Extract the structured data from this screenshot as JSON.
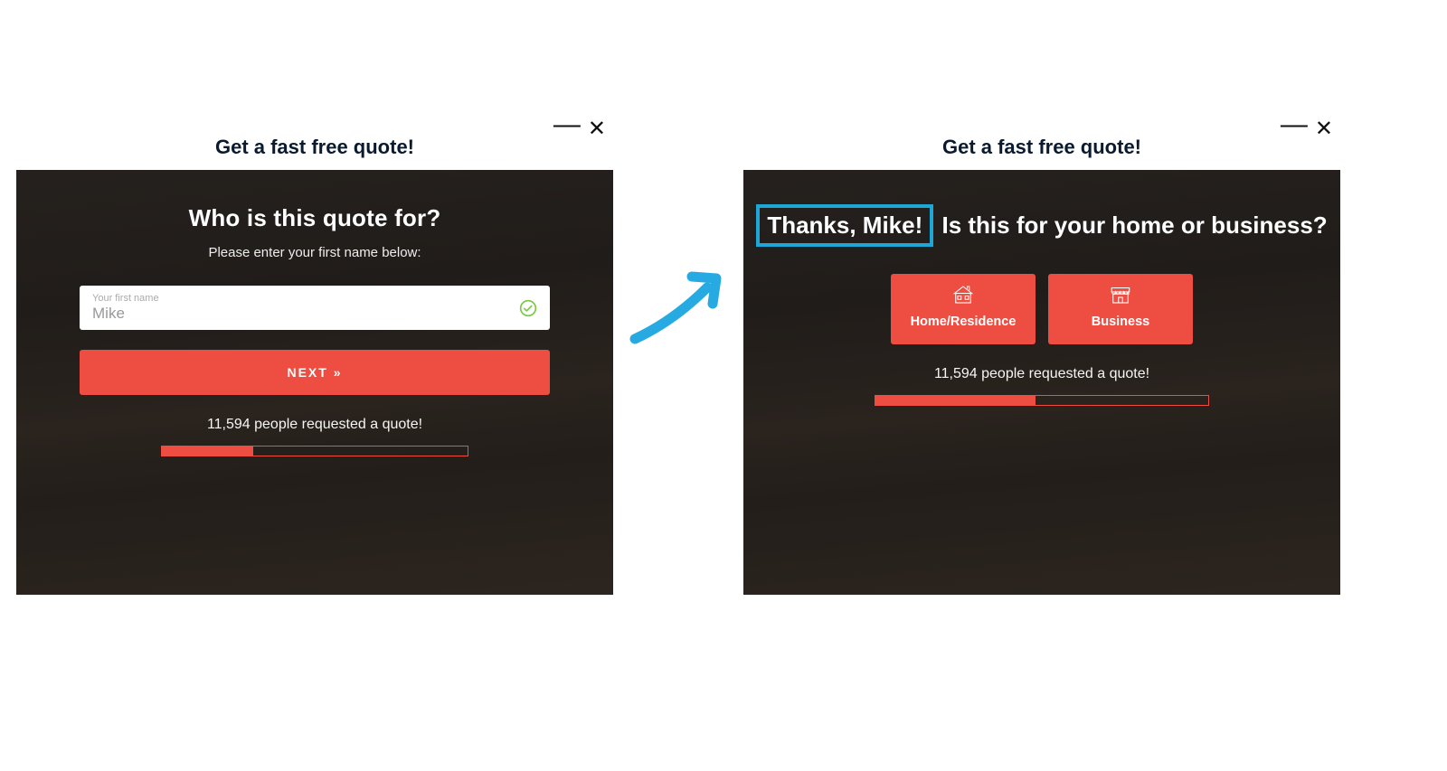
{
  "left_panel": {
    "window_title": "Get a fast free quote!",
    "heading": "Who is this quote for?",
    "subheading": "Please enter your first name below:",
    "input_label": "Your first name",
    "input_value": "Mike",
    "next_button_label": "NEXT »",
    "requested_text": "11,594 people requested a quote!",
    "progress_percent": 30
  },
  "right_panel": {
    "window_title": "Get a fast free quote!",
    "heading_highlight": "Thanks, Mike!",
    "heading_rest": " Is this for your home or business?",
    "choice_home_label": "Home/Residence",
    "choice_business_label": "Business",
    "requested_text": "11,594 people requested a quote!",
    "progress_percent": 48
  }
}
